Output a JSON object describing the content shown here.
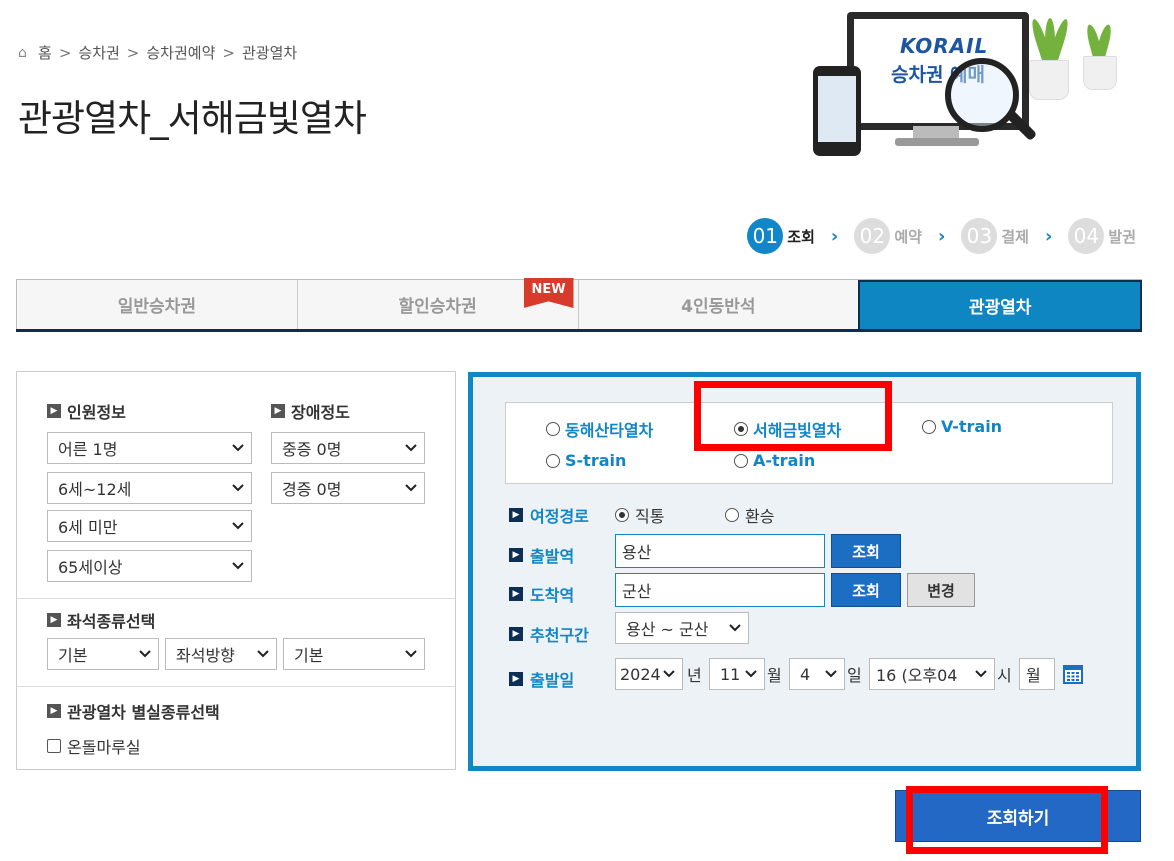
{
  "breadcrumb": {
    "home": "홈",
    "items": [
      "승차권",
      "승차권예약",
      "관광열차"
    ]
  },
  "page_title": "관광열차_서해금빛열차",
  "illustration": {
    "brand": "KORAIL",
    "subtitle": "승차권 예매"
  },
  "steps": [
    {
      "num": "01",
      "label": "조회",
      "active": true
    },
    {
      "num": "02",
      "label": "예약",
      "active": false
    },
    {
      "num": "03",
      "label": "결제",
      "active": false
    },
    {
      "num": "04",
      "label": "발권",
      "active": false
    }
  ],
  "tabs": [
    {
      "label": "일반승차권",
      "active": false
    },
    {
      "label": "할인승차권",
      "active": false,
      "badge": "NEW"
    },
    {
      "label": "4인동반석",
      "active": false
    },
    {
      "label": "관광열차",
      "active": true
    }
  ],
  "left_panel": {
    "passenger_info": {
      "title": "인원정보",
      "selects": [
        "어른 1명",
        "6세~12세",
        "6세 미만",
        "65세이상"
      ]
    },
    "disability": {
      "title": "장애정도",
      "selects": [
        "중증 0명",
        "경증 0명"
      ]
    },
    "seat_type": {
      "title": "좌석종류선택",
      "selects": [
        "기본",
        "좌석방향",
        "기본"
      ]
    },
    "room_type": {
      "title": "관광열차 별실종류선택",
      "checkbox_label": "온돌마루실",
      "checked": false
    }
  },
  "right_panel": {
    "trains": [
      {
        "label": "동해산타열차",
        "checked": false
      },
      {
        "label": "서해금빛열차",
        "checked": true
      },
      {
        "label": "V-train",
        "checked": false
      },
      {
        "label": "S-train",
        "checked": false
      },
      {
        "label": "A-train",
        "checked": false
      }
    ],
    "route": {
      "label": "여정경로",
      "options": [
        {
          "label": "직통",
          "checked": true
        },
        {
          "label": "환승",
          "checked": false
        }
      ]
    },
    "departure": {
      "label": "출발역",
      "value": "용산",
      "button": "조회"
    },
    "arrival": {
      "label": "도착역",
      "value": "군산",
      "button": "조회",
      "swap_button": "변경"
    },
    "recommended": {
      "label": "추천구간",
      "value": "용산 ~ 군산"
    },
    "date": {
      "label": "출발일",
      "year": "2024",
      "year_unit": "년",
      "month": "11",
      "month_unit": "월",
      "day": "4",
      "day_unit": "일",
      "hour": "16 (오후04",
      "hour_unit": "시",
      "weekday": "월"
    }
  },
  "search_button": "조회하기",
  "colors": {
    "accent": "#0f88c4",
    "highlight": "#ff0000",
    "button_blue": "#2268c4"
  }
}
